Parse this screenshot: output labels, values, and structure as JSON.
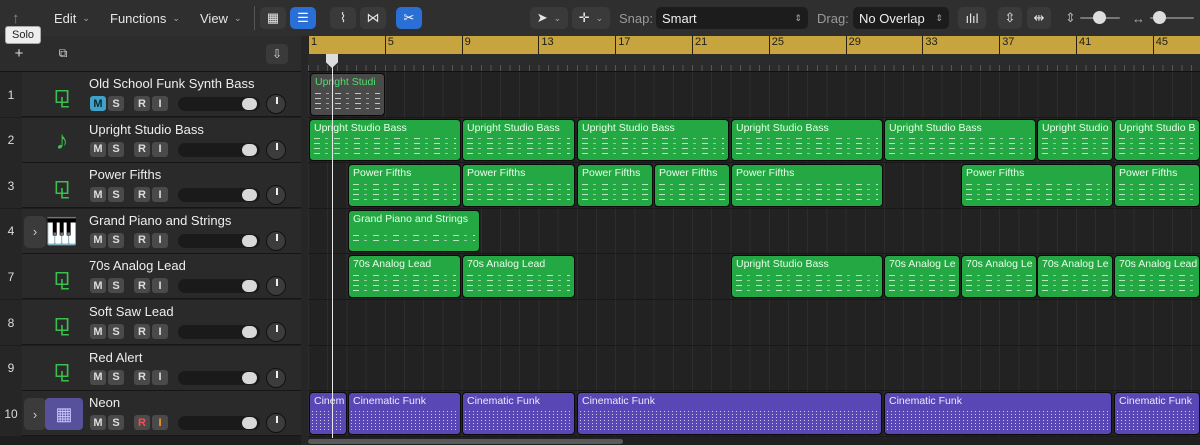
{
  "toolbar": {
    "menus": [
      {
        "label": "Edit"
      },
      {
        "label": "Functions"
      },
      {
        "label": "View"
      }
    ],
    "snap_label": "Snap:",
    "snap_value": "Smart",
    "drag_label": "Drag:",
    "drag_value": "No Overlap"
  },
  "tooltip": "Solo",
  "ruler": {
    "bars": [
      "1",
      "5",
      "9",
      "13",
      "17",
      "21",
      "25",
      "29",
      "33",
      "37",
      "41",
      "45"
    ]
  },
  "tracks": [
    {
      "number": "1",
      "name": "Old School Funk Synth Bass",
      "icon": "keyboard-icon",
      "mute_active": true
    },
    {
      "number": "2",
      "name": "Upright Studio Bass",
      "icon": "bass-icon"
    },
    {
      "number": "3",
      "name": "Power Fifths",
      "icon": "keyboard-icon"
    },
    {
      "number": "4",
      "name": "Grand Piano and Strings",
      "icon": "piano-icon"
    },
    {
      "number": "7",
      "name": "70s Analog Lead",
      "icon": "keyboard-icon"
    },
    {
      "number": "8",
      "name": "Soft Saw Lead",
      "icon": "keyboard-icon"
    },
    {
      "number": "9",
      "name": "Red Alert",
      "icon": "keyboard-icon"
    },
    {
      "number": "10",
      "name": "Neon",
      "icon": "drum-machine-icon",
      "record_armed": true
    }
  ],
  "buttons": {
    "mute": "M",
    "solo": "S",
    "record": "R",
    "input": "I"
  },
  "regions": {
    "t1": [
      "Upright Studi"
    ],
    "t2": [
      "Upright Studio Bass",
      "Upright Studio Bass",
      "Upright Studio Bass",
      "Upright Studio Bass",
      "Upright Studio Bass",
      "Upright Studio",
      "Upright Studio B"
    ],
    "t3": [
      "Power Fifths",
      "Power Fifths",
      "Power Fifths",
      "Power Fifths",
      "Power Fifths",
      "Power Fifths",
      "Power Fifths"
    ],
    "t4": [
      "Grand Piano and Strings"
    ],
    "t7": [
      "70s Analog Lead",
      "70s Analog Lead",
      "Upright Studio Bass",
      "70s Analog Le",
      "70s Analog Le",
      "70s Analog Le",
      "70s Analog Lead"
    ],
    "t10": [
      "Cinem",
      "Cinematic Funk",
      "Cinematic Funk",
      "Cinematic Funk",
      "Cinematic Funk",
      "Cinematic Funk"
    ]
  },
  "colors": {
    "region_green": "#23a843",
    "region_purple": "#5a47b6",
    "ruler_gold": "#c8a43f",
    "accent_blue": "#2a6fd6"
  }
}
